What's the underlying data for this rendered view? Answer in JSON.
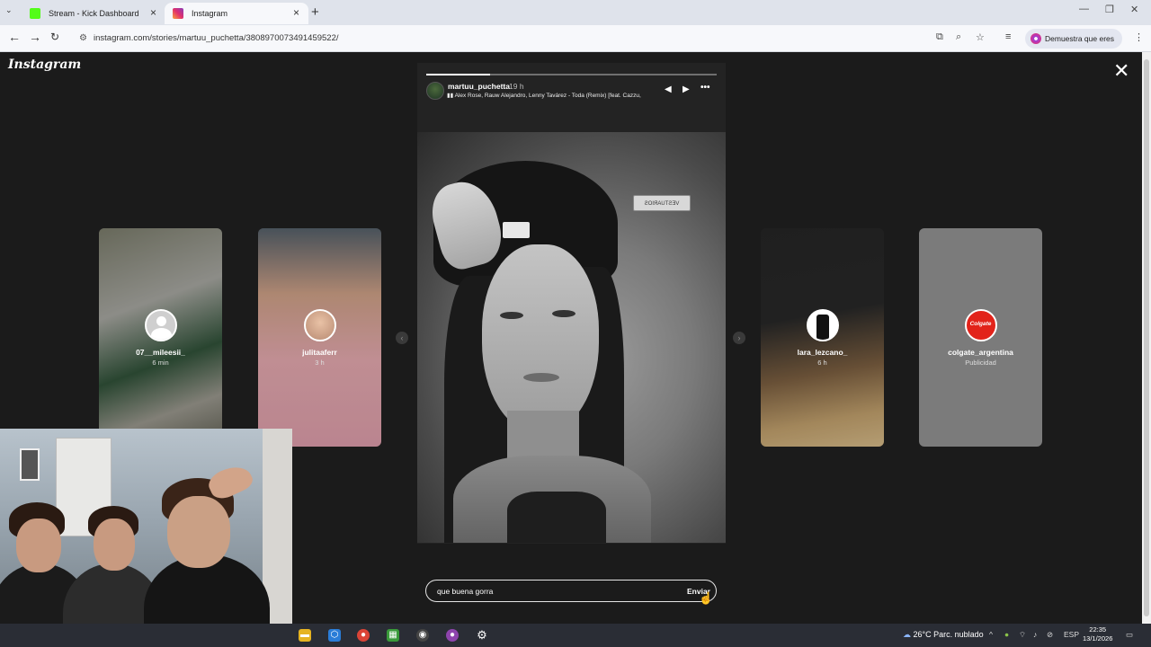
{
  "browser": {
    "tabs": [
      {
        "title": "Stream - Kick Dashboard",
        "active": false,
        "favicon_color": "#53fc18"
      },
      {
        "title": "Instagram",
        "active": true,
        "favicon_color": "#e1306c"
      }
    ],
    "url": "instagram.com/stories/martuu_puchetta/3808970073491459522/",
    "profile_label": "Demuestra que eres tú"
  },
  "instagram": {
    "logo": "Instagram",
    "side_stories": [
      {
        "username": "07__mileesii_",
        "time": "6 min"
      },
      {
        "username": "julitaaferr",
        "time": "3 h"
      },
      {
        "username": "lara_lezcano_",
        "time": "6 h"
      },
      {
        "username": "colgate_argentina",
        "time": "Publicidad",
        "logo_text": "Colgate"
      }
    ],
    "story": {
      "username": "martuu_puchetta",
      "time": "19 h",
      "song": "Alex Rose, Rauw Alejandro, Lenny Tavárez - Toda (Remix) [feat. Cazzu,",
      "progress": 0.22,
      "sticker_text": "VESTUARIOS"
    },
    "reply": {
      "value": "que buena gorra",
      "send_label": "Enviar"
    }
  },
  "taskbar": {
    "weather": "26°C  Parc. nublado",
    "language": "ESP",
    "time": "22:35",
    "date": "13/1/2026"
  },
  "colors": {
    "background": "#1b1b1b",
    "colgate_red": "#e2231a",
    "instagram_pink": "#e1306c"
  }
}
